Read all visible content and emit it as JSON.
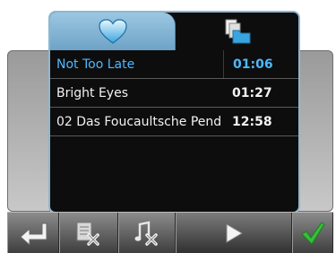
{
  "tabs": [
    {
      "icon": "heart-icon",
      "active": true,
      "color": "#9bc7e2"
    },
    {
      "icon": "file-folder-icon",
      "active": false
    }
  ],
  "playlist": [
    {
      "title": "Not Too Late",
      "duration": "01:06",
      "selected": true
    },
    {
      "title": "Bright Eyes",
      "duration": "01:27",
      "selected": false
    },
    {
      "title": "02 Das Foucaultsche Pend",
      "duration": "12:58",
      "selected": false
    }
  ],
  "toolbar": {
    "buttons": [
      "back-arrow-icon",
      "delete-item-icon",
      "delete-track-icon",
      "play-icon",
      "checkmark-icon"
    ]
  },
  "colors": {
    "selected_text": "#4db8ff",
    "accent_green": "#34c038",
    "tab_blue": "#9bc7e2"
  }
}
